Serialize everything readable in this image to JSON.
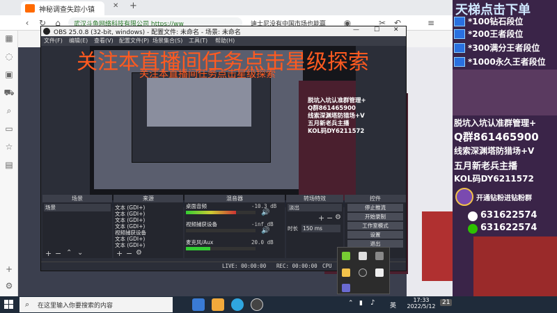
{
  "browser": {
    "tab_title": "神秘调查失踪小镇",
    "address": "武汉斗鱼网络科技有限公司 https://ww",
    "notify": "迪士尼没有中国市场也能赢",
    "icons": [
      "back-icon",
      "forward-icon",
      "refresh-icon",
      "home-icon",
      "star-icon",
      "menu-icon"
    ]
  },
  "obs": {
    "title": "OBS 25.0.8 (32-bit, windows) - 配置文件: 未命名 - 场景: 未命名",
    "menus": [
      "文件(F)",
      "编辑(E)",
      "查看(V)",
      "配置文件(P)",
      "场景集合(S)",
      "工具(T)",
      "帮助(H)"
    ],
    "docks": {
      "scenes": {
        "title": "场景",
        "items": [
          "场景"
        ]
      },
      "sources": {
        "title": "来源",
        "items": [
          "文本 (GDI+)",
          "文本 (GDI+)",
          "文本 (GDI+)",
          "文本 (GDI+)",
          "视频捕获设备",
          "文本 (GDI+)",
          "文本 (GDI+)"
        ]
      },
      "mixer": {
        "title": "混音器",
        "channels": [
          {
            "name": "桌面音频",
            "db": "-10.3 dB",
            "level": 0.72
          },
          {
            "name": "视频捕获设备",
            "db": "-inf dB",
            "level": 0.0
          },
          {
            "name": "麦克风/Aux",
            "db": "20.0 dB",
            "level": 0.35
          }
        ]
      },
      "transitions": {
        "title": "转场特效",
        "type": "淡出",
        "duration_label": "时长",
        "duration": "150 ms"
      },
      "controls": {
        "title": "控件",
        "buttons": [
          "停止推流",
          "开始录制",
          "工作室模式",
          "设置",
          "退出"
        ]
      }
    },
    "status": {
      "live": "LIVE: 00:00:00",
      "rec": "REC: 00:00:00",
      "cpu": "CPU"
    }
  },
  "overlay": {
    "banner": "关注本直播间任务点击星级探索",
    "banner_small": "关注本直播间任务点击星级探索",
    "side_text": [
      "脱坑入坑认准群管理+",
      "Q群861465900",
      "线索深渊塔防猎场+V",
      "五月新老兵主播",
      "KOL码DY6211572"
    ]
  },
  "right_panel": {
    "header": "天梯点击下单",
    "items": [
      "*100钻石段位",
      "*200王者段位",
      "*300满分王者段位",
      "*1000永久王者段位"
    ],
    "promo": [
      "脱坑入坑认准群管理+",
      "Q群861465900",
      "线索深渊塔防猎场+V",
      "五月新老兵主播",
      "KOL码DY6211572"
    ],
    "join": "开通钻粉进钻粉群",
    "qq1": "631622574",
    "qq2": "631622574"
  },
  "taskbar": {
    "search_placeholder": "在这里输入你要搜索的内容",
    "time": "17:33",
    "date": "2022/5/12",
    "ime": "英",
    "notif_count": "21"
  },
  "colors": {
    "accent_red": "#ff5a20",
    "obs_bg": "#2b2e38",
    "right_bg": "#3a2448",
    "link_blue": "#5ab4ff"
  }
}
